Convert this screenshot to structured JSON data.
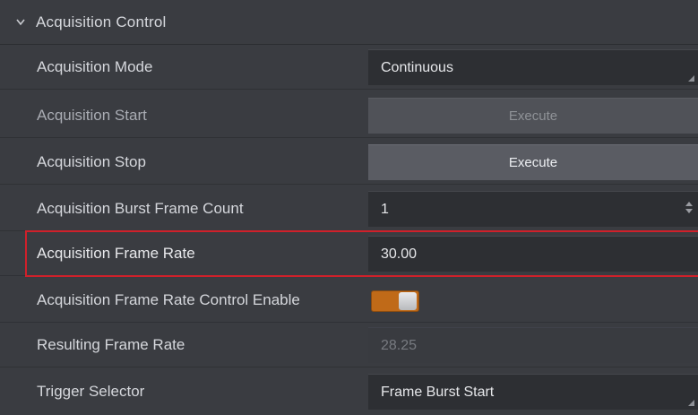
{
  "section": {
    "title": "Acquisition Control",
    "chevron_icon": "chevron-down-icon"
  },
  "rows": [
    {
      "label": "Acquisition Mode",
      "value": "Continuous",
      "kind": "dropdown"
    },
    {
      "label": "Acquisition Start",
      "value": "Execute",
      "kind": "button-disabled"
    },
    {
      "label": "Acquisition Stop",
      "value": "Execute",
      "kind": "button"
    },
    {
      "label": "Acquisition Burst Frame Count",
      "value": "1",
      "kind": "spinner"
    },
    {
      "label": "Acquisition Frame Rate",
      "value": "30.00",
      "kind": "text",
      "highlighted": true
    },
    {
      "label": "Acquisition Frame Rate Control Enable",
      "value_on": true,
      "kind": "toggle"
    },
    {
      "label": "Resulting Frame Rate",
      "value": "28.25",
      "kind": "readonly"
    },
    {
      "label": "Trigger Selector",
      "value": "Frame Burst Start",
      "kind": "dropdown"
    }
  ],
  "colors": {
    "panel_bg": "#3a3c41",
    "field_bg": "#2d2f33",
    "highlight_border": "#d0202a",
    "toggle_on": "#c06a18"
  }
}
